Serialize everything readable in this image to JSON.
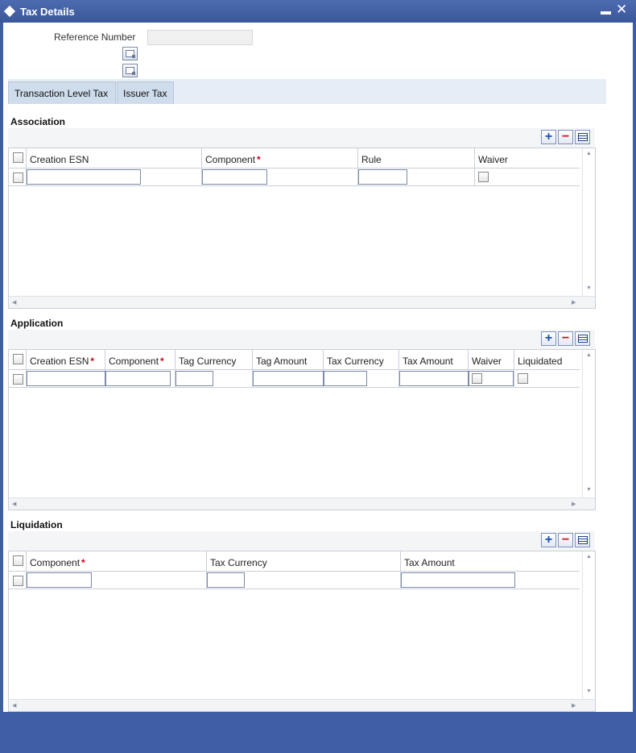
{
  "window": {
    "title": "Tax Details",
    "minimize_icon": "minimize-icon",
    "close_icon": "close-icon",
    "minimize_glyph": "▬",
    "close_glyph": "✕"
  },
  "header": {
    "reference_label": "Reference Number",
    "reference_value": ""
  },
  "tabs": [
    {
      "label": "Transaction Level Tax"
    },
    {
      "label": "Issuer Tax"
    }
  ],
  "association": {
    "title": "Association",
    "columns": [
      "Creation ESN",
      "Component",
      "Rule",
      "Waiver"
    ],
    "required": [
      false,
      true,
      false,
      false
    ]
  },
  "application": {
    "title": "Application",
    "columns": [
      "Creation ESN",
      "Component",
      "Tag Currency",
      "Tag Amount",
      "Tax Currency",
      "Tax Amount",
      "Waiver",
      "Liquidated"
    ],
    "required": [
      true,
      true,
      false,
      false,
      false,
      false,
      false,
      false
    ]
  },
  "liquidation": {
    "title": "Liquidation",
    "columns": [
      "Component",
      "Tax Currency",
      "Tax Amount"
    ],
    "required": [
      true,
      false,
      false
    ]
  },
  "toolbar": {
    "add_glyph": "+",
    "delete_glyph": "−",
    "required_mark": "*",
    "scroll_up": "▲",
    "scroll_down": "▼",
    "scroll_left": "◀",
    "scroll_right": "▶"
  },
  "colors": {
    "frame": "#3f5ea4",
    "required": "#d0021b",
    "tab_bg": "#cfdcec"
  }
}
